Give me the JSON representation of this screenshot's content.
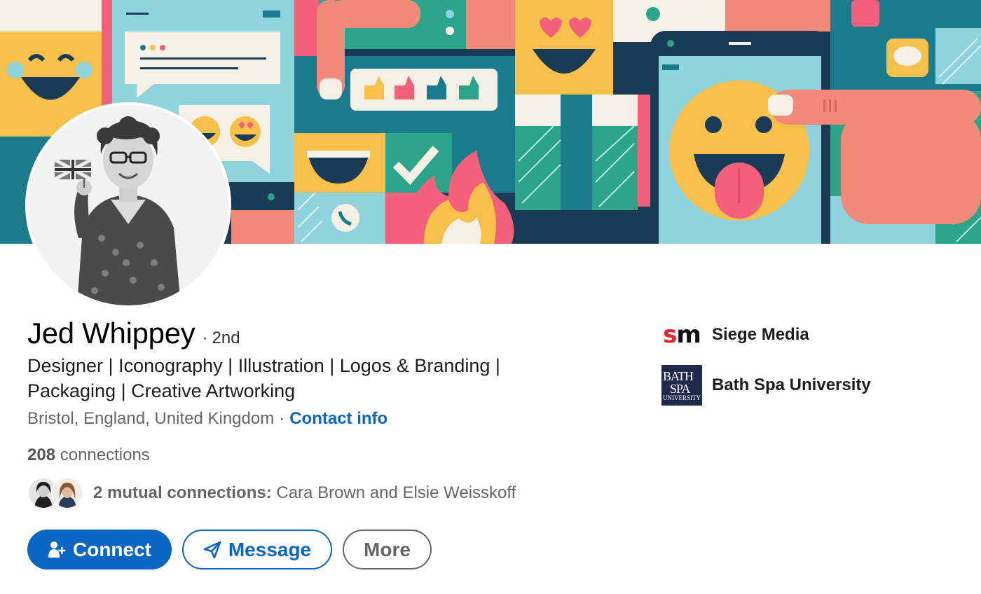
{
  "profile": {
    "name": "Jed Whippey",
    "degree": "2nd",
    "headline": "Designer | Iconography | Illustration | Logos & Branding | Packaging | Creative Artworking",
    "location": "Bristol, England, United Kingdom",
    "contact_label": "Contact info",
    "connections_count": "208",
    "connections_label": "connections",
    "mutual_prefix": "2 mutual connections:",
    "mutual_names": "Cara Brown and Elsie Weisskoff"
  },
  "actions": {
    "connect_label": "Connect",
    "message_label": "Message",
    "more_label": "More"
  },
  "organizations": [
    {
      "name": "Siege Media",
      "logo": "sm"
    },
    {
      "name": "Bath Spa University",
      "logo_lines": [
        "BATH",
        "SPA",
        "UNIVERSITY"
      ]
    }
  ],
  "colors": {
    "accent": "#0a66c2",
    "secondary_text": "#666666",
    "siege_red": "#e8222a",
    "bath_navy": "#1f2a4a"
  },
  "icons": {
    "connect": "add-person-icon",
    "message": "send-icon"
  }
}
